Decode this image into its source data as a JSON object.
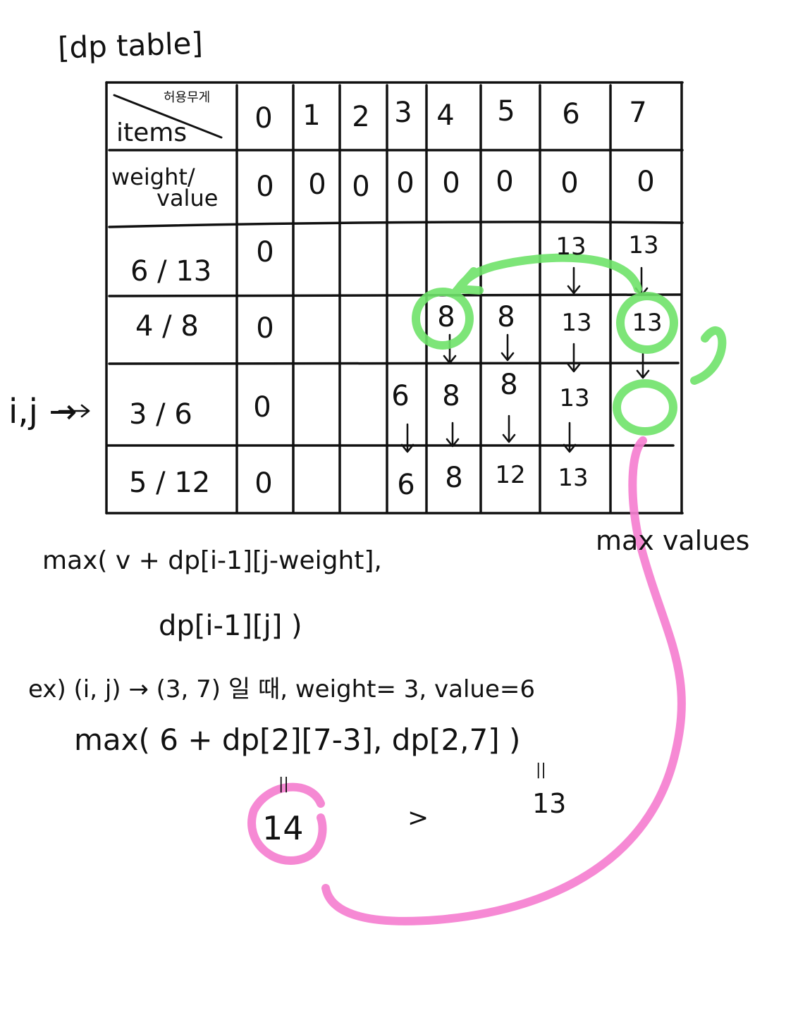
{
  "title": "[dp table]",
  "header": {
    "corner_top": "허용무게",
    "corner_bottom": "items",
    "capacities": [
      "0",
      "1",
      "2",
      "3",
      "4",
      "5",
      "6",
      "7"
    ]
  },
  "init_row": {
    "label_line1": "weight/",
    "label_line2": "value",
    "values": [
      "0",
      "0",
      "0",
      "0",
      "0",
      "0",
      "0",
      "0"
    ]
  },
  "rows": [
    {
      "label": "6 / 13",
      "cells": [
        "0",
        "",
        "",
        "",
        "",
        "",
        "13",
        "13"
      ]
    },
    {
      "label": "4 / 8",
      "cells": [
        "0",
        "",
        "",
        "",
        "8",
        "8",
        "13",
        "13"
      ]
    },
    {
      "label": "3 / 6",
      "cells": [
        "0",
        "",
        "",
        "6",
        "8",
        "8",
        "13",
        ""
      ]
    },
    {
      "label": "5 / 12",
      "cells": [
        "0",
        "",
        "",
        "6",
        "8",
        "12",
        "13",
        ""
      ]
    }
  ],
  "pointer_label": "i,j →",
  "max_values_label": "max values",
  "formula_line1": "max( v + dp[i-1][j-weight],",
  "formula_line2": "dp[i-1][j] )",
  "example_line1": "ex) (i, j) → (3, 7) 일 때, weight= 3, value=6",
  "example_line2": "max( 6 + dp[2][7-3], dp[2,7] )",
  "result_left_eq": "||",
  "result_left": "14",
  "comparison": ">",
  "result_right_eq": "||",
  "result_right": "13",
  "colors": {
    "green": "#6fe36a",
    "pink": "#f57fd0",
    "ink": "#111111"
  }
}
